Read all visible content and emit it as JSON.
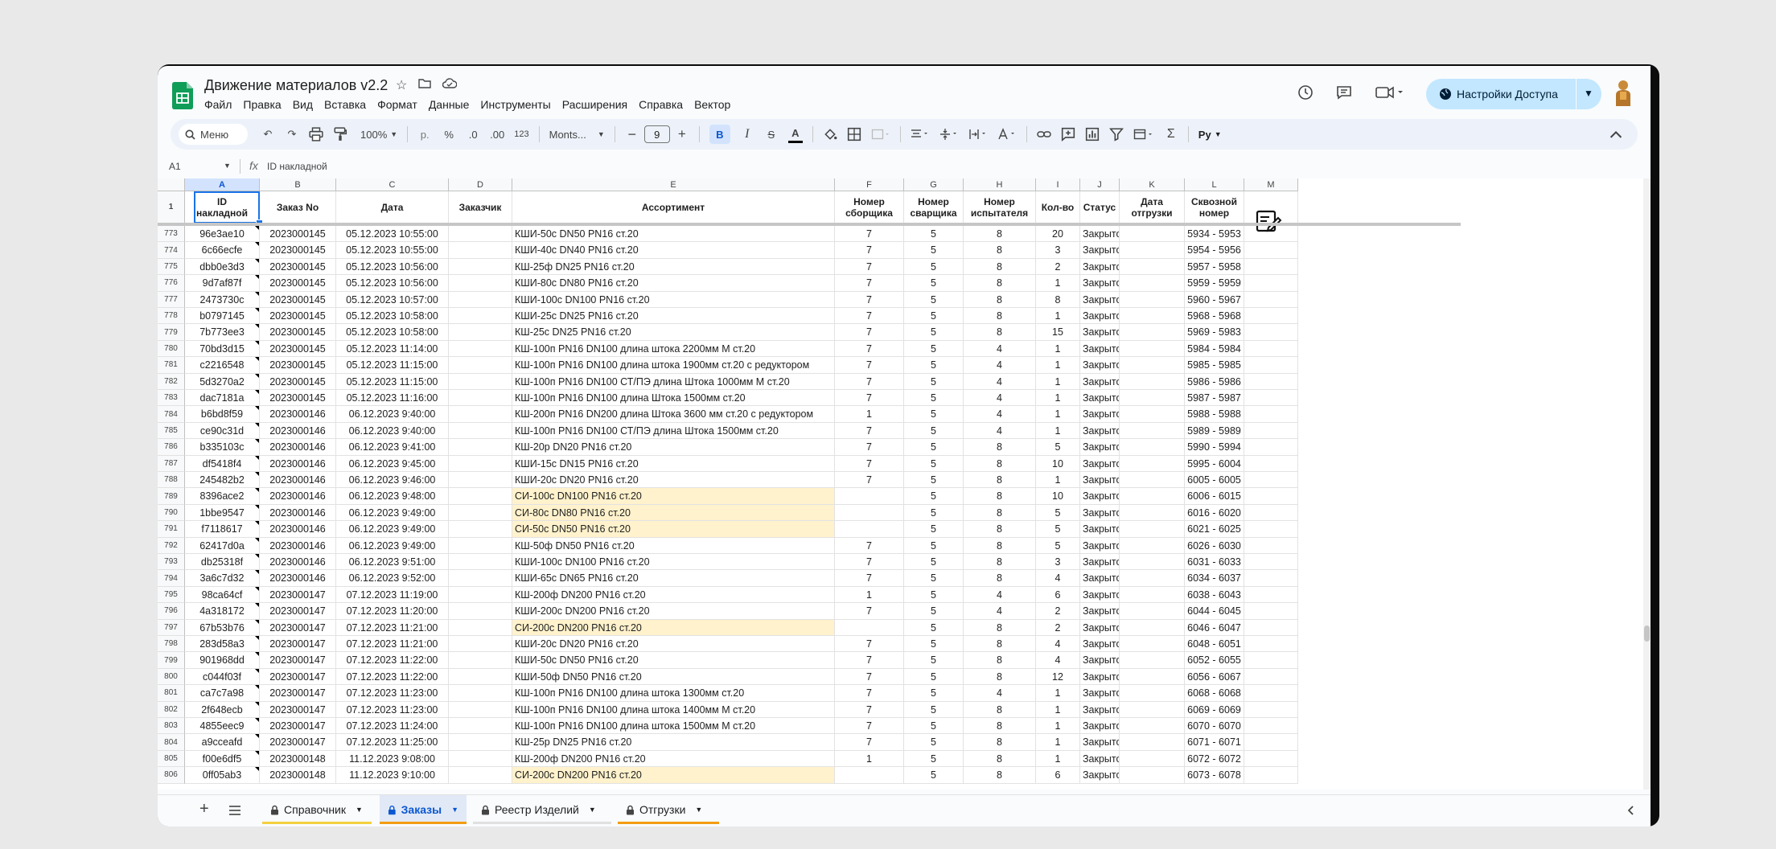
{
  "doc": {
    "title": "Движение материалов v2.2",
    "menu": [
      "Файл",
      "Правка",
      "Вид",
      "Вставка",
      "Формат",
      "Данные",
      "Инструменты",
      "Расширения",
      "Справка",
      "Вектор"
    ],
    "share_label": "Настройки Доступа"
  },
  "toolbar": {
    "search_label": "Меню",
    "zoom": "100%",
    "currency": "р.",
    "percent": "%",
    "dec_decrease": ".0",
    "dec_increase": ".00",
    "number_format": "123",
    "font": "Monts...",
    "font_size": "9",
    "bold": "B",
    "italic": "I",
    "strike": "S",
    "text_color": "A",
    "sigma": "Σ",
    "addon": "Рy"
  },
  "formula": {
    "namebox": "A1",
    "fx": "fx",
    "value": "ID накладной"
  },
  "columns": [
    "A",
    "B",
    "C",
    "D",
    "E",
    "F",
    "G",
    "H",
    "I",
    "J",
    "K",
    "L",
    "M"
  ],
  "header_row_num": "1",
  "headers": [
    "ID\nнакладной",
    "Заказ No",
    "Дата",
    "Заказчик",
    "Ассортимент",
    "Номер\nсборщика",
    "Номер\nсварщика",
    "Номер\nиспытателя",
    "Кол-во",
    "Статус",
    "Дата\nотгрузки",
    "Сквозной\nномер",
    ""
  ],
  "rows": [
    {
      "n": "773",
      "id": "96e3ae10",
      "order": "2023000145",
      "date": "05.12.2023 10:55:00",
      "item": "КШИ-50с DN50  PN16  ст.20",
      "f": "7",
      "g": "5",
      "h": "8",
      "qty": "20",
      "status": "Закрыто",
      "range": "5934 - 5953",
      "hl": false
    },
    {
      "n": "774",
      "id": "6c66ecfe",
      "order": "2023000145",
      "date": "05.12.2023 10:55:00",
      "item": "КШИ-40с DN40  PN16  ст.20",
      "f": "7",
      "g": "5",
      "h": "8",
      "qty": "3",
      "status": "Закрыто",
      "range": "5954 - 5956",
      "hl": false
    },
    {
      "n": "775",
      "id": "dbb0e3d3",
      "order": "2023000145",
      "date": "05.12.2023 10:56:00",
      "item": "КШ-25ф DN25  PN16  ст.20",
      "f": "7",
      "g": "5",
      "h": "8",
      "qty": "2",
      "status": "Закрыто",
      "range": "5957 - 5958",
      "hl": false
    },
    {
      "n": "776",
      "id": "9d7af87f",
      "order": "2023000145",
      "date": "05.12.2023 10:56:00",
      "item": "КШИ-80с DN80  PN16  ст.20",
      "f": "7",
      "g": "5",
      "h": "8",
      "qty": "1",
      "status": "Закрыто",
      "range": "5959 - 5959",
      "hl": false
    },
    {
      "n": "777",
      "id": "2473730c",
      "order": "2023000145",
      "date": "05.12.2023 10:57:00",
      "item": "КШИ-100с DN100  PN16  ст.20",
      "f": "7",
      "g": "5",
      "h": "8",
      "qty": "8",
      "status": "Закрыто",
      "range": "5960 - 5967",
      "hl": false
    },
    {
      "n": "778",
      "id": "b0797145",
      "order": "2023000145",
      "date": "05.12.2023 10:58:00",
      "item": "КШИ-25с DN25  PN16  ст.20",
      "f": "7",
      "g": "5",
      "h": "8",
      "qty": "1",
      "status": "Закрыто",
      "range": "5968 - 5968",
      "hl": false
    },
    {
      "n": "779",
      "id": "7b773ee3",
      "order": "2023000145",
      "date": "05.12.2023 10:58:00",
      "item": "КШ-25с DN25  PN16  ст.20",
      "f": "7",
      "g": "5",
      "h": "8",
      "qty": "15",
      "status": "Закрыто",
      "range": "5969 - 5983",
      "hl": false
    },
    {
      "n": "780",
      "id": "70bd3d15",
      "order": "2023000145",
      "date": "05.12.2023 11:14:00",
      "item": "КШ-100п PN16 DN100  длина штока 2200мм М ст.20",
      "f": "7",
      "g": "5",
      "h": "4",
      "qty": "1",
      "status": "Закрыто",
      "range": "5984 - 5984",
      "hl": false
    },
    {
      "n": "781",
      "id": "c2216548",
      "order": "2023000145",
      "date": "05.12.2023 11:15:00",
      "item": "КШ-100п PN16 DN100  длина штока 1900мм  ст.20 с редуктором",
      "f": "7",
      "g": "5",
      "h": "4",
      "qty": "1",
      "status": "Закрыто",
      "range": "5985 - 5985",
      "hl": false
    },
    {
      "n": "782",
      "id": "5d3270a2",
      "order": "2023000145",
      "date": "05.12.2023 11:15:00",
      "item": "КШ-100п PN16 DN100  СТ/ПЭ длина Штока 1000мм М ст.20",
      "f": "7",
      "g": "5",
      "h": "4",
      "qty": "1",
      "status": "Закрыто",
      "range": "5986 - 5986",
      "hl": false
    },
    {
      "n": "783",
      "id": "dac7181a",
      "order": "2023000145",
      "date": "05.12.2023 11:16:00",
      "item": "КШ-100п PN16 DN100 длина Штока 1500мм  ст.20",
      "f": "7",
      "g": "5",
      "h": "4",
      "qty": "1",
      "status": "Закрыто",
      "range": "5987 - 5987",
      "hl": false
    },
    {
      "n": "784",
      "id": "b6bd8f59",
      "order": "2023000146",
      "date": "06.12.2023 9:40:00",
      "item": "КШ-200п PN16 DN200 длина Штока 3600 мм  ст.20 с редуктором",
      "f": "1",
      "g": "5",
      "h": "4",
      "qty": "1",
      "status": "Закрыто",
      "range": "5988 - 5988",
      "hl": false
    },
    {
      "n": "785",
      "id": "ce90c31d",
      "order": "2023000146",
      "date": "06.12.2023 9:40:00",
      "item": "КШ-100п PN16 DN100  СТ/ПЭ длина Штока 1500мм  ст.20",
      "f": "7",
      "g": "5",
      "h": "4",
      "qty": "1",
      "status": "Закрыто",
      "range": "5989 - 5989",
      "hl": false
    },
    {
      "n": "786",
      "id": "b335103c",
      "order": "2023000146",
      "date": "06.12.2023 9:41:00",
      "item": "КШ-20р DN20  PN16  ст.20",
      "f": "7",
      "g": "5",
      "h": "8",
      "qty": "5",
      "status": "Закрыто",
      "range": "5990 - 5994",
      "hl": false
    },
    {
      "n": "787",
      "id": "df5418f4",
      "order": "2023000146",
      "date": "06.12.2023 9:45:00",
      "item": "КШИ-15с DN15  PN16  ст.20",
      "f": "7",
      "g": "5",
      "h": "8",
      "qty": "10",
      "status": "Закрыто",
      "range": "5995 - 6004",
      "hl": false
    },
    {
      "n": "788",
      "id": "245482b2",
      "order": "2023000146",
      "date": "06.12.2023 9:46:00",
      "item": "КШИ-20с DN20  PN16  ст.20",
      "f": "7",
      "g": "5",
      "h": "8",
      "qty": "1",
      "status": "Закрыто",
      "range": "6005 - 6005",
      "hl": false
    },
    {
      "n": "789",
      "id": "8396ace2",
      "order": "2023000146",
      "date": "06.12.2023 9:48:00",
      "item": "СИ-100с DN100  PN16  ст.20",
      "f": "",
      "g": "5",
      "h": "8",
      "qty": "10",
      "status": "Закрыто",
      "range": "6006 - 6015",
      "hl": true
    },
    {
      "n": "790",
      "id": "1bbe9547",
      "order": "2023000146",
      "date": "06.12.2023 9:49:00",
      "item": "СИ-80с DN80  PN16  ст.20",
      "f": "",
      "g": "5",
      "h": "8",
      "qty": "5",
      "status": "Закрыто",
      "range": "6016 - 6020",
      "hl": true
    },
    {
      "n": "791",
      "id": "f7118617",
      "order": "2023000146",
      "date": "06.12.2023 9:49:00",
      "item": "СИ-50с DN50  PN16  ст.20",
      "f": "",
      "g": "5",
      "h": "8",
      "qty": "5",
      "status": "Закрыто",
      "range": "6021 - 6025",
      "hl": true
    },
    {
      "n": "792",
      "id": "62417d0a",
      "order": "2023000146",
      "date": "06.12.2023 9:49:00",
      "item": "КШ-50ф DN50  PN16  ст.20",
      "f": "7",
      "g": "5",
      "h": "8",
      "qty": "5",
      "status": "Закрыто",
      "range": "6026 - 6030",
      "hl": false
    },
    {
      "n": "793",
      "id": "db25318f",
      "order": "2023000146",
      "date": "06.12.2023 9:51:00",
      "item": "КШИ-100с DN100  PN16  ст.20",
      "f": "7",
      "g": "5",
      "h": "8",
      "qty": "3",
      "status": "Закрыто",
      "range": "6031 - 6033",
      "hl": false
    },
    {
      "n": "794",
      "id": "3a6c7d32",
      "order": "2023000146",
      "date": "06.12.2023 9:52:00",
      "item": "КШИ-65с DN65  PN16  ст.20",
      "f": "7",
      "g": "5",
      "h": "8",
      "qty": "4",
      "status": "Закрыто",
      "range": "6034 - 6037",
      "hl": false
    },
    {
      "n": "795",
      "id": "98ca64cf",
      "order": "2023000147",
      "date": "07.12.2023 11:19:00",
      "item": "КШ-200ф DN200  PN16  ст.20",
      "f": "1",
      "g": "5",
      "h": "4",
      "qty": "6",
      "status": "Закрыто",
      "range": "6038 - 6043",
      "hl": false
    },
    {
      "n": "796",
      "id": "4a318172",
      "order": "2023000147",
      "date": "07.12.2023 11:20:00",
      "item": "КШИ-200с DN200  PN16  ст.20",
      "f": "7",
      "g": "5",
      "h": "4",
      "qty": "2",
      "status": "Закрыто",
      "range": "6044 - 6045",
      "hl": false
    },
    {
      "n": "797",
      "id": "67b53b76",
      "order": "2023000147",
      "date": "07.12.2023 11:21:00",
      "item": "СИ-200с DN200  PN16  ст.20",
      "f": "",
      "g": "5",
      "h": "8",
      "qty": "2",
      "status": "Закрыто",
      "range": "6046 - 6047",
      "hl": true
    },
    {
      "n": "798",
      "id": "283d58a3",
      "order": "2023000147",
      "date": "07.12.2023 11:21:00",
      "item": "КШИ-20с DN20  PN16  ст.20",
      "f": "7",
      "g": "5",
      "h": "8",
      "qty": "4",
      "status": "Закрыто",
      "range": "6048 - 6051",
      "hl": false
    },
    {
      "n": "799",
      "id": "901968dd",
      "order": "2023000147",
      "date": "07.12.2023 11:22:00",
      "item": "КШИ-50с DN50  PN16  ст.20",
      "f": "7",
      "g": "5",
      "h": "8",
      "qty": "4",
      "status": "Закрыто",
      "range": "6052 - 6055",
      "hl": false
    },
    {
      "n": "800",
      "id": "c044f03f",
      "order": "2023000147",
      "date": "07.12.2023 11:22:00",
      "item": "КШИ-50ф DN50  PN16  ст.20",
      "f": "7",
      "g": "5",
      "h": "8",
      "qty": "12",
      "status": "Закрыто",
      "range": "6056 - 6067",
      "hl": false
    },
    {
      "n": "801",
      "id": "ca7c7a98",
      "order": "2023000147",
      "date": "07.12.2023 11:23:00",
      "item": "КШ-100п PN16 DN100  длина штока 1300мм  ст.20",
      "f": "7",
      "g": "5",
      "h": "4",
      "qty": "1",
      "status": "Закрыто",
      "range": "6068 - 6068",
      "hl": false
    },
    {
      "n": "802",
      "id": "2f648ecb",
      "order": "2023000147",
      "date": "07.12.2023 11:23:00",
      "item": "КШ-100п PN16 DN100  длина штока 1400мм М ст.20",
      "f": "7",
      "g": "5",
      "h": "8",
      "qty": "1",
      "status": "Закрыто",
      "range": "6069 - 6069",
      "hl": false
    },
    {
      "n": "803",
      "id": "4855eec9",
      "order": "2023000147",
      "date": "07.12.2023 11:24:00",
      "item": "КШ-100п PN16 DN100  длина штока 1500мм М  ст.20",
      "f": "7",
      "g": "5",
      "h": "8",
      "qty": "1",
      "status": "Закрыто",
      "range": "6070 - 6070",
      "hl": false
    },
    {
      "n": "804",
      "id": "a9cceafd",
      "order": "2023000147",
      "date": "07.12.2023 11:25:00",
      "item": "КШ-25р DN25  PN16  ст.20",
      "f": "7",
      "g": "5",
      "h": "8",
      "qty": "1",
      "status": "Закрыто",
      "range": "6071 - 6071",
      "hl": false
    },
    {
      "n": "805",
      "id": "f00e6df5",
      "order": "2023000148",
      "date": "11.12.2023 9:08:00",
      "item": "КШ-200ф DN200  PN16  ст.20",
      "f": "1",
      "g": "5",
      "h": "8",
      "qty": "1",
      "status": "Закрыто",
      "range": "6072 - 6072",
      "hl": false
    },
    {
      "n": "806",
      "id": "0ff05ab3",
      "order": "2023000148",
      "date": "11.12.2023 9:10:00",
      "item": "СИ-200с DN200  PN16  ст.20",
      "f": "",
      "g": "5",
      "h": "8",
      "qty": "6",
      "status": "Закрыто",
      "range": "6073 - 6078",
      "hl": true
    }
  ],
  "sheets": [
    {
      "label": "Справочник",
      "active": false,
      "color": "#f4d03f"
    },
    {
      "label": "Заказы",
      "active": true,
      "color": "#f39c12"
    },
    {
      "label": "Реестр Изделий",
      "active": false,
      "color": "#e0e0e0"
    },
    {
      "label": "Отгрузки",
      "active": false,
      "color": "#f39c12"
    }
  ],
  "colors": {
    "accent": "#0b57d0",
    "share_bg": "#c2e7ff",
    "highlight": "#fff2cc",
    "sheets_green": "#0f9d58"
  }
}
